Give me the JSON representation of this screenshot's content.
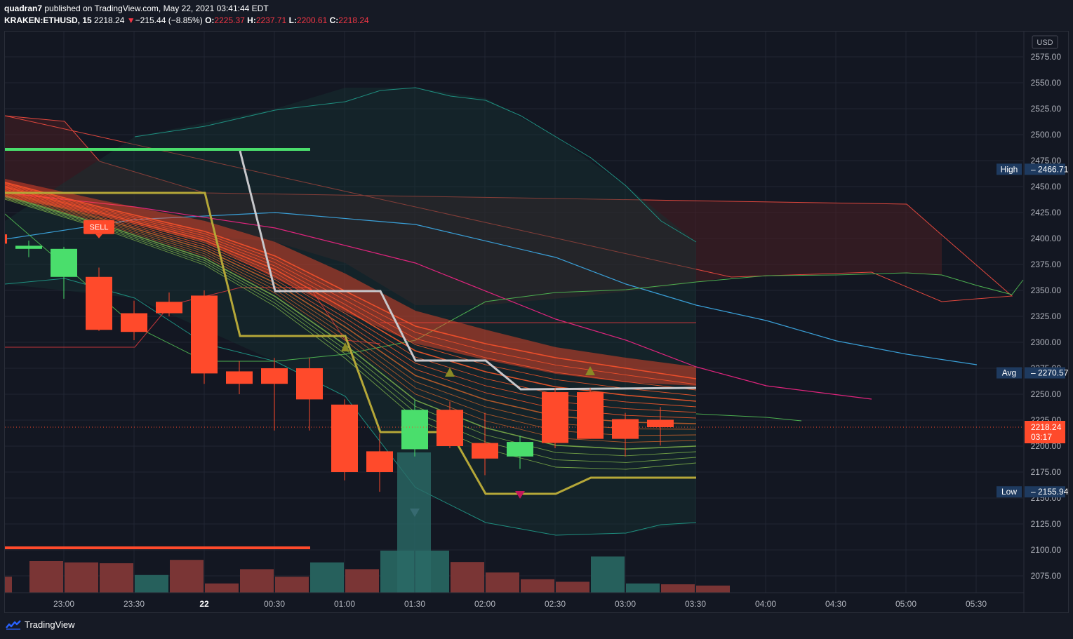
{
  "header": {
    "publisher": "quadran7",
    "published_text": "published on TradingView.com, May 22, 2021 03:41:44 EDT",
    "symbol": "KRAKEN:ETHUSD, 15",
    "last": "2218.24",
    "change_arrow": "▼",
    "change": "−215.44 (−8.85%)",
    "o_label": "O:",
    "o_value": "2225.37",
    "h_label": "H:",
    "h_value": "2237.71",
    "l_label": "L:",
    "l_value": "2200.61",
    "c_label": "C:",
    "c_value": "2218.24"
  },
  "footer": {
    "brand": "TradingView",
    "logo_icon": "tradingview-logo-icon"
  },
  "colors": {
    "up": "#4ade6c",
    "down": "#ff4a2b",
    "vol_up": "#26605c",
    "vol_down": "#7a3535",
    "bg": "#131722",
    "grid": "#202533"
  },
  "chart_data": {
    "type": "candlestick",
    "currency_label": "USD",
    "y_ticks": [
      "2575.00",
      "2550.00",
      "2525.00",
      "2500.00",
      "2475.00",
      "2450.00",
      "2425.00",
      "2400.00",
      "2375.00",
      "2350.00",
      "2325.00",
      "2300.00",
      "2275.00",
      "2250.00",
      "2225.00",
      "2200.00",
      "2175.00",
      "2150.00",
      "2125.00",
      "2100.00",
      "2075.00"
    ],
    "ylim": [
      2060,
      2590
    ],
    "x_ticks": [
      "23:00",
      "23:30",
      "22",
      "00:30",
      "01:00",
      "01:30",
      "02:00",
      "02:30",
      "03:00",
      "03:30",
      "04:00",
      "04:30",
      "05:00",
      "05:30"
    ],
    "grid": true,
    "candles": [
      {
        "t": "22:45",
        "o": 2404,
        "h": 2412,
        "l": 2388,
        "c": 2395
      },
      {
        "t": "23:00",
        "o": 2390,
        "h": 2398,
        "l": 2382,
        "c": 2393
      },
      {
        "t": "23:15",
        "o": 2363,
        "h": 2392,
        "l": 2342,
        "c": 2390
      },
      {
        "t": "23:30",
        "o": 2363,
        "h": 2372,
        "l": 2311,
        "c": 2312
      },
      {
        "t": "23:45",
        "o": 2328,
        "h": 2340,
        "l": 2302,
        "c": 2310
      },
      {
        "t": "00:00",
        "o": 2339,
        "h": 2348,
        "l": 2325,
        "c": 2328
      },
      {
        "t": "00:15",
        "o": 2345,
        "h": 2350,
        "l": 2260,
        "c": 2270
      },
      {
        "t": "00:30",
        "o": 2272,
        "h": 2282,
        "l": 2250,
        "c": 2260
      },
      {
        "t": "00:45",
        "o": 2275,
        "h": 2285,
        "l": 2215,
        "c": 2260
      },
      {
        "t": "01:00",
        "o": 2275,
        "h": 2285,
        "l": 2215,
        "c": 2245
      },
      {
        "t": "01:15",
        "o": 2240,
        "h": 2245,
        "l": 2167,
        "c": 2175
      },
      {
        "t": "01:30",
        "o": 2195,
        "h": 2212,
        "l": 2156,
        "c": 2175
      },
      {
        "t": "01:45",
        "o": 2197,
        "h": 2244,
        "l": 2190,
        "c": 2235
      },
      {
        "t": "02:00",
        "o": 2235,
        "h": 2243,
        "l": 2198,
        "c": 2200
      },
      {
        "t": "02:15",
        "o": 2203,
        "h": 2232,
        "l": 2172,
        "c": 2188
      },
      {
        "t": "02:30",
        "o": 2190,
        "h": 2210,
        "l": 2178,
        "c": 2204
      },
      {
        "t": "02:45",
        "o": 2252,
        "h": 2256,
        "l": 2198,
        "c": 2203
      },
      {
        "t": "03:00",
        "o": 2252,
        "h": 2256,
        "l": 2207,
        "c": 2207
      },
      {
        "t": "03:15",
        "o": 2226,
        "h": 2232,
        "l": 2190,
        "c": 2207
      },
      {
        "t": "03:30",
        "o": 2225.37,
        "h": 2237.71,
        "l": 2200.61,
        "c": 2218.24
      }
    ],
    "volume_relative": [
      0.38,
      0.75,
      0.72,
      0.7,
      0.42,
      0.78,
      0.22,
      0.56,
      0.38,
      0.72,
      0.56,
      1.0,
      1.0,
      0.73,
      0.48,
      0.32,
      0.26,
      0.86,
      0.22,
      0.2,
      0.17
    ],
    "levels": {
      "high": {
        "label": "High",
        "value": "2466.71"
      },
      "avg": {
        "label": "Avg",
        "value": "2270.57"
      },
      "last": {
        "value": "2218.24",
        "countdown": "03:17"
      },
      "low": {
        "label": "Low",
        "value": "2155.94"
      }
    },
    "annotations": [
      {
        "text": "SELL",
        "t": "23:30",
        "price": 2411
      }
    ]
  }
}
